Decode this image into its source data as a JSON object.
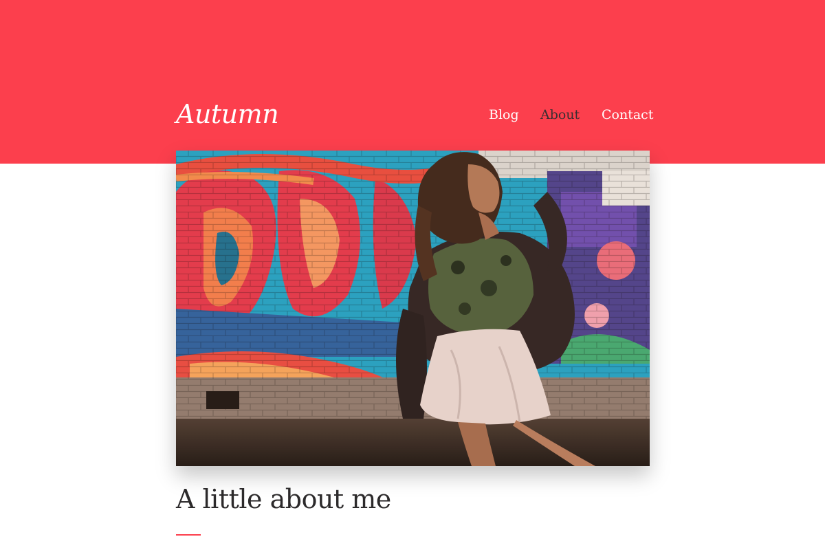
{
  "site": {
    "title": "Autumn"
  },
  "nav": {
    "items": [
      {
        "label": "Blog"
      },
      {
        "label": "About"
      },
      {
        "label": "Contact"
      }
    ],
    "active": "About"
  },
  "main": {
    "heading": "A little about me"
  },
  "colors": {
    "brand": "#fc3f4d",
    "active_nav": "#3a2e31",
    "heading": "#2c2a2b"
  }
}
